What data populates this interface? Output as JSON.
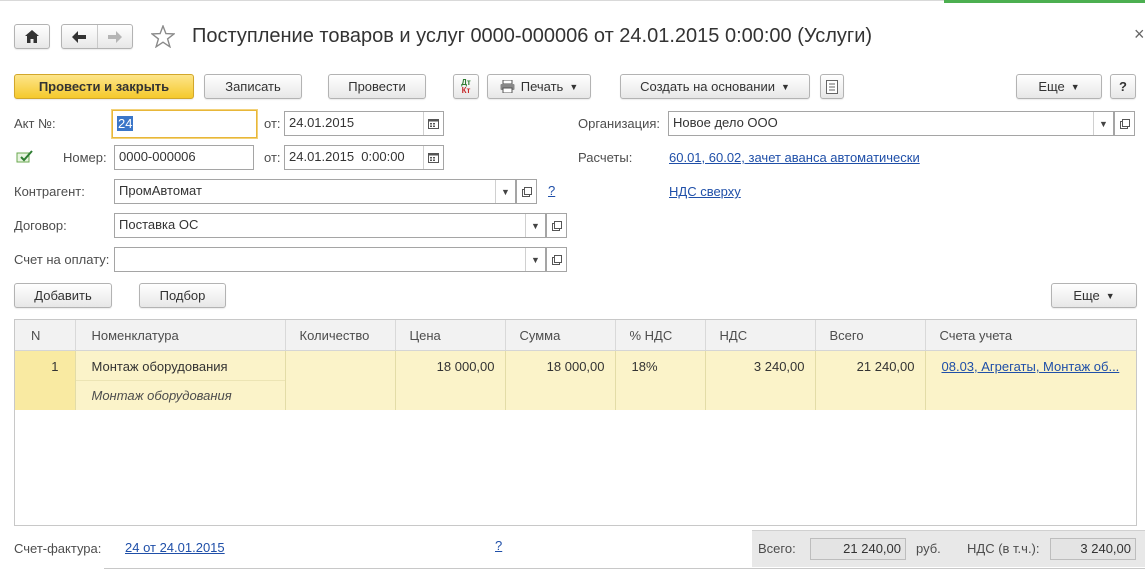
{
  "header": {
    "title": "Поступление товаров и услуг 0000-000006 от 24.01.2015 0:00:00 (Услуги)",
    "close_glyph": "×"
  },
  "toolbar": {
    "post_close_label": "Провести и закрыть",
    "save_label": "Записать",
    "post_label": "Провести",
    "dtkt_top": "Дт",
    "dtkt_bottom": "Кт",
    "print_label": "Печать",
    "create_based_label": "Создать на основании",
    "more_label": "Еще",
    "help_label": "?"
  },
  "form": {
    "act_label": "Акт №:",
    "act_value": "24",
    "from_label": "от:",
    "act_date": "24.01.2015",
    "number_label": "Номер:",
    "number_value": "0000-000006",
    "from_label2": "от:",
    "number_date": "24.01.2015  0:00:00",
    "contractor_label": "Контрагент:",
    "contractor_value": "ПромАвтомат",
    "contractor_help": "?",
    "contract_label": "Договор:",
    "contract_value": "Поставка ОС",
    "invoice_pay_label": "Счет на оплату:",
    "invoice_pay_value": "",
    "org_label": "Организация:",
    "org_value": "Новое дело ООО",
    "settlements_label": "Расчеты:",
    "settlements_link": "60.01, 60.02, зачет аванса автоматически",
    "vat_link": "НДС сверху"
  },
  "table_toolbar": {
    "add_label": "Добавить",
    "pick_label": "Подбор",
    "more_label": "Еще"
  },
  "table": {
    "columns": [
      "N",
      "Номенклатура",
      "Количество",
      "Цена",
      "Сумма",
      "% НДС",
      "НДС",
      "Всего",
      "Счета учета"
    ],
    "rows": [
      {
        "n": "1",
        "nomenclature": "Монтаж оборудования",
        "content": "Монтаж оборудования",
        "quantity": "",
        "price": "18 000,00",
        "sum": "18 000,00",
        "vat_rate": "18%",
        "vat": "3 240,00",
        "total": "21 240,00",
        "accounts": "08.03, Агрегаты, Монтаж об..."
      }
    ]
  },
  "footer": {
    "invoice_label": "Счет-фактура:",
    "invoice_link": "24 от 24.01.2015",
    "help": "?",
    "total_label": "Всего:",
    "total_value": "21 240,00",
    "currency": "руб.",
    "vat_label": "НДС (в т.ч.):",
    "vat_value": "3 240,00"
  },
  "colors": {
    "primary_button": "#f5c92c",
    "selected_row": "#fbf3c9",
    "link": "#1f4fa8",
    "focus_border": "#e8b739"
  }
}
